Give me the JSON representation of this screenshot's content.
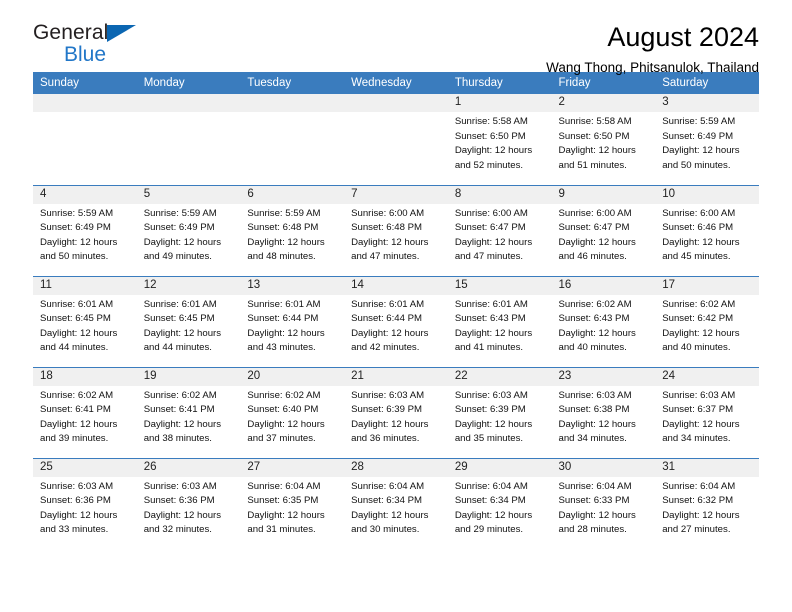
{
  "brand": {
    "name_part1": "General",
    "name_part2": "Blue",
    "flag_icon": "flag-icon"
  },
  "header": {
    "title": "August 2024",
    "subtitle": "Wang Thong, Phitsanulok, Thailand"
  },
  "colors": {
    "header_blue": "#3a7cbe",
    "brand_blue": "#2277c8",
    "flag_blue": "#0b66b2",
    "daynum_band": "#f0f0f0"
  },
  "columns": [
    "Sunday",
    "Monday",
    "Tuesday",
    "Wednesday",
    "Thursday",
    "Friday",
    "Saturday"
  ],
  "weeks": [
    [
      {
        "day": "",
        "lines": []
      },
      {
        "day": "",
        "lines": []
      },
      {
        "day": "",
        "lines": []
      },
      {
        "day": "",
        "lines": []
      },
      {
        "day": "1",
        "lines": [
          "Sunrise: 5:58 AM",
          "Sunset: 6:50 PM",
          "Daylight: 12 hours",
          "and 52 minutes."
        ]
      },
      {
        "day": "2",
        "lines": [
          "Sunrise: 5:58 AM",
          "Sunset: 6:50 PM",
          "Daylight: 12 hours",
          "and 51 minutes."
        ]
      },
      {
        "day": "3",
        "lines": [
          "Sunrise: 5:59 AM",
          "Sunset: 6:49 PM",
          "Daylight: 12 hours",
          "and 50 minutes."
        ]
      }
    ],
    [
      {
        "day": "4",
        "lines": [
          "Sunrise: 5:59 AM",
          "Sunset: 6:49 PM",
          "Daylight: 12 hours",
          "and 50 minutes."
        ]
      },
      {
        "day": "5",
        "lines": [
          "Sunrise: 5:59 AM",
          "Sunset: 6:49 PM",
          "Daylight: 12 hours",
          "and 49 minutes."
        ]
      },
      {
        "day": "6",
        "lines": [
          "Sunrise: 5:59 AM",
          "Sunset: 6:48 PM",
          "Daylight: 12 hours",
          "and 48 minutes."
        ]
      },
      {
        "day": "7",
        "lines": [
          "Sunrise: 6:00 AM",
          "Sunset: 6:48 PM",
          "Daylight: 12 hours",
          "and 47 minutes."
        ]
      },
      {
        "day": "8",
        "lines": [
          "Sunrise: 6:00 AM",
          "Sunset: 6:47 PM",
          "Daylight: 12 hours",
          "and 47 minutes."
        ]
      },
      {
        "day": "9",
        "lines": [
          "Sunrise: 6:00 AM",
          "Sunset: 6:47 PM",
          "Daylight: 12 hours",
          "and 46 minutes."
        ]
      },
      {
        "day": "10",
        "lines": [
          "Sunrise: 6:00 AM",
          "Sunset: 6:46 PM",
          "Daylight: 12 hours",
          "and 45 minutes."
        ]
      }
    ],
    [
      {
        "day": "11",
        "lines": [
          "Sunrise: 6:01 AM",
          "Sunset: 6:45 PM",
          "Daylight: 12 hours",
          "and 44 minutes."
        ]
      },
      {
        "day": "12",
        "lines": [
          "Sunrise: 6:01 AM",
          "Sunset: 6:45 PM",
          "Daylight: 12 hours",
          "and 44 minutes."
        ]
      },
      {
        "day": "13",
        "lines": [
          "Sunrise: 6:01 AM",
          "Sunset: 6:44 PM",
          "Daylight: 12 hours",
          "and 43 minutes."
        ]
      },
      {
        "day": "14",
        "lines": [
          "Sunrise: 6:01 AM",
          "Sunset: 6:44 PM",
          "Daylight: 12 hours",
          "and 42 minutes."
        ]
      },
      {
        "day": "15",
        "lines": [
          "Sunrise: 6:01 AM",
          "Sunset: 6:43 PM",
          "Daylight: 12 hours",
          "and 41 minutes."
        ]
      },
      {
        "day": "16",
        "lines": [
          "Sunrise: 6:02 AM",
          "Sunset: 6:43 PM",
          "Daylight: 12 hours",
          "and 40 minutes."
        ]
      },
      {
        "day": "17",
        "lines": [
          "Sunrise: 6:02 AM",
          "Sunset: 6:42 PM",
          "Daylight: 12 hours",
          "and 40 minutes."
        ]
      }
    ],
    [
      {
        "day": "18",
        "lines": [
          "Sunrise: 6:02 AM",
          "Sunset: 6:41 PM",
          "Daylight: 12 hours",
          "and 39 minutes."
        ]
      },
      {
        "day": "19",
        "lines": [
          "Sunrise: 6:02 AM",
          "Sunset: 6:41 PM",
          "Daylight: 12 hours",
          "and 38 minutes."
        ]
      },
      {
        "day": "20",
        "lines": [
          "Sunrise: 6:02 AM",
          "Sunset: 6:40 PM",
          "Daylight: 12 hours",
          "and 37 minutes."
        ]
      },
      {
        "day": "21",
        "lines": [
          "Sunrise: 6:03 AM",
          "Sunset: 6:39 PM",
          "Daylight: 12 hours",
          "and 36 minutes."
        ]
      },
      {
        "day": "22",
        "lines": [
          "Sunrise: 6:03 AM",
          "Sunset: 6:39 PM",
          "Daylight: 12 hours",
          "and 35 minutes."
        ]
      },
      {
        "day": "23",
        "lines": [
          "Sunrise: 6:03 AM",
          "Sunset: 6:38 PM",
          "Daylight: 12 hours",
          "and 34 minutes."
        ]
      },
      {
        "day": "24",
        "lines": [
          "Sunrise: 6:03 AM",
          "Sunset: 6:37 PM",
          "Daylight: 12 hours",
          "and 34 minutes."
        ]
      }
    ],
    [
      {
        "day": "25",
        "lines": [
          "Sunrise: 6:03 AM",
          "Sunset: 6:36 PM",
          "Daylight: 12 hours",
          "and 33 minutes."
        ]
      },
      {
        "day": "26",
        "lines": [
          "Sunrise: 6:03 AM",
          "Sunset: 6:36 PM",
          "Daylight: 12 hours",
          "and 32 minutes."
        ]
      },
      {
        "day": "27",
        "lines": [
          "Sunrise: 6:04 AM",
          "Sunset: 6:35 PM",
          "Daylight: 12 hours",
          "and 31 minutes."
        ]
      },
      {
        "day": "28",
        "lines": [
          "Sunrise: 6:04 AM",
          "Sunset: 6:34 PM",
          "Daylight: 12 hours",
          "and 30 minutes."
        ]
      },
      {
        "day": "29",
        "lines": [
          "Sunrise: 6:04 AM",
          "Sunset: 6:34 PM",
          "Daylight: 12 hours",
          "and 29 minutes."
        ]
      },
      {
        "day": "30",
        "lines": [
          "Sunrise: 6:04 AM",
          "Sunset: 6:33 PM",
          "Daylight: 12 hours",
          "and 28 minutes."
        ]
      },
      {
        "day": "31",
        "lines": [
          "Sunrise: 6:04 AM",
          "Sunset: 6:32 PM",
          "Daylight: 12 hours",
          "and 27 minutes."
        ]
      }
    ]
  ]
}
